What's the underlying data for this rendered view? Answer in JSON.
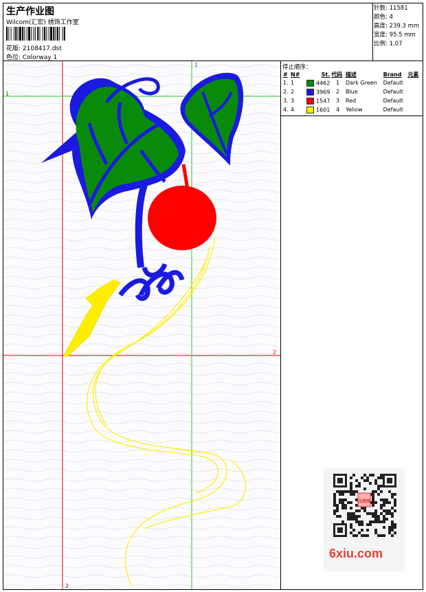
{
  "header": {
    "title": "生产作业图",
    "subtitle": "Wilcom(汇宏) 绣饰工作室",
    "design_label": "花版: 2108417.dst",
    "colorway_label": "色位:  Colorway 1"
  },
  "stats": {
    "stitches": "针数: 11581",
    "colors": "颜色: 4",
    "height": "高度: 239.3 mm",
    "width": "宽度: 95.5 mm",
    "scale": "比例: 1.07"
  },
  "stop_sequence": {
    "title": "停止顺序：",
    "columns": [
      "#",
      "N#",
      "St.",
      "代码",
      "描述",
      "Brand",
      "元素"
    ],
    "rows": [
      {
        "idx": "1.",
        "n": "1",
        "color": "#0a8a0a",
        "st": "4462",
        "code": "1",
        "desc": "Dark Green",
        "brand": "Default"
      },
      {
        "idx": "2.",
        "n": "2",
        "color": "#1a1ae0",
        "st": "3969",
        "code": "2",
        "desc": "Blue",
        "brand": "Default"
      },
      {
        "idx": "3.",
        "n": "3",
        "color": "#ff0000",
        "st": "1547",
        "code": "3",
        "desc": "Red",
        "brand": "Default"
      },
      {
        "idx": "4.",
        "n": "4",
        "color": "#ffee00",
        "st": "1601",
        "code": "4",
        "desc": "Yellow",
        "brand": "Default"
      }
    ]
  },
  "guides": {
    "label_1": "1",
    "label_2": "2"
  },
  "watermark": {
    "brand_text": "6xiu.com",
    "stamp_text": "汉绣图"
  }
}
